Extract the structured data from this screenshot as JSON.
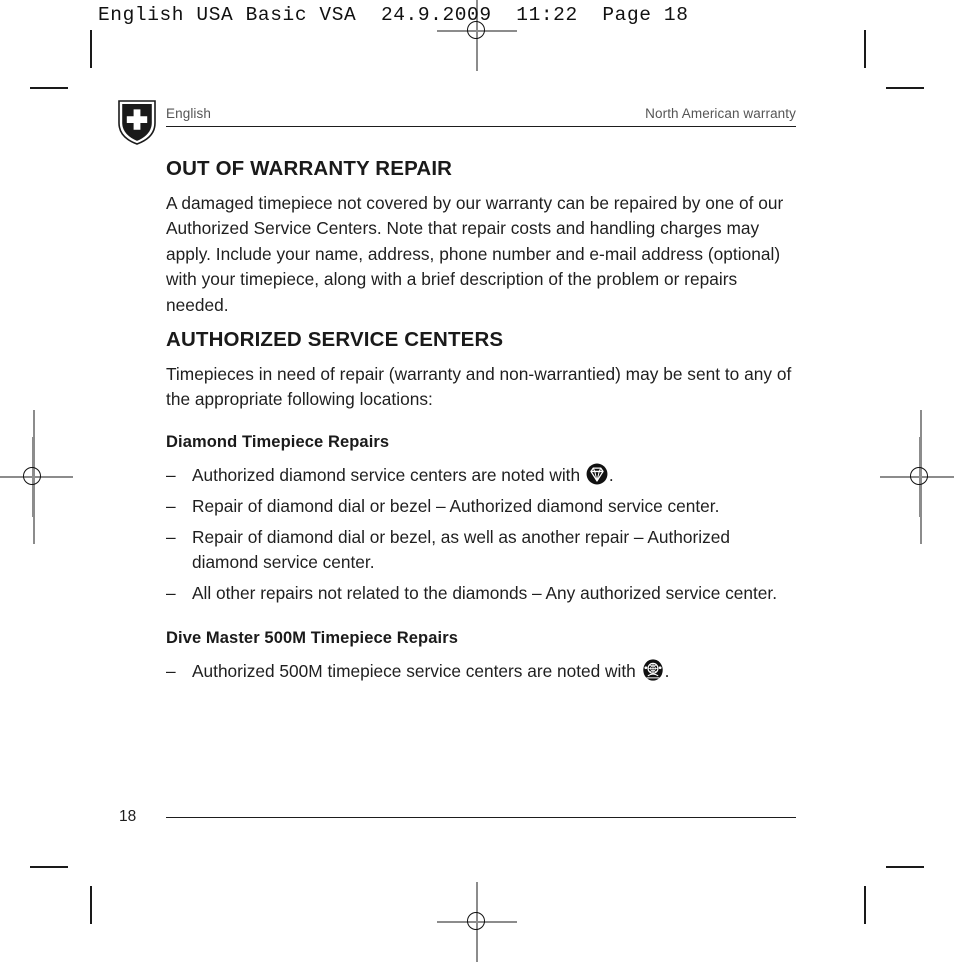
{
  "printer_slug": "English USA Basic VSA  24.9.2009  11:22  Page 18",
  "running_head": {
    "left": "English",
    "right": "North American warranty",
    "logo_icon": "victorinox-shield-icon"
  },
  "sections": [
    {
      "heading": "OUT OF WARRANTY REPAIR",
      "paragraph": "A damaged timepiece not covered by our warranty can be repaired by one of our Authorized Service Centers. Note that repair costs and handling charges may apply. Include your name, address, phone number and e-mail address (optional) with your timepiece, along with a brief description of the problem or repairs needed."
    },
    {
      "heading": "AUTHORIZED SERVICE CENTERS",
      "paragraph": "Timepieces in need of repair (warranty and non-warrantied) may be sent to any of the appropriate following locations:"
    }
  ],
  "subsections": [
    {
      "heading": "Diamond Timepiece Repairs",
      "bullets": [
        {
          "dash": "–",
          "text_before": "Authorized diamond service centers are noted with ",
          "icon": "diamond-badge-icon",
          "text_after": "."
        },
        {
          "dash": "–",
          "text_before": "Repair of diamond dial or bezel – Authorized diamond service center.",
          "icon": "",
          "text_after": ""
        },
        {
          "dash": "–",
          "text_before": "Repair of diamond dial or bezel, as well as another repair – Authorized diamond service center.",
          "icon": "",
          "text_after": ""
        },
        {
          "dash": "–",
          "text_before": "All other repairs not related to the diamonds – Any authorized service center.",
          "icon": "",
          "text_after": ""
        }
      ]
    },
    {
      "heading": "Dive Master 500M Timepiece Repairs",
      "bullets": [
        {
          "dash": "–",
          "text_before": "Authorized 500M timepiece service centers are noted with ",
          "icon": "dive-helmet-badge-icon",
          "text_after": "."
        }
      ]
    }
  ],
  "folio": {
    "page_number": "18"
  },
  "colors": {
    "body_text": "#1f1f1f",
    "heading_text": "#1a1a1a",
    "running_head_text": "#555555",
    "rule": "#1d1d1d",
    "mark_black": "#1a1a1a",
    "mark_gray": "#8c8c8c",
    "icon_fill": "#111111"
  }
}
